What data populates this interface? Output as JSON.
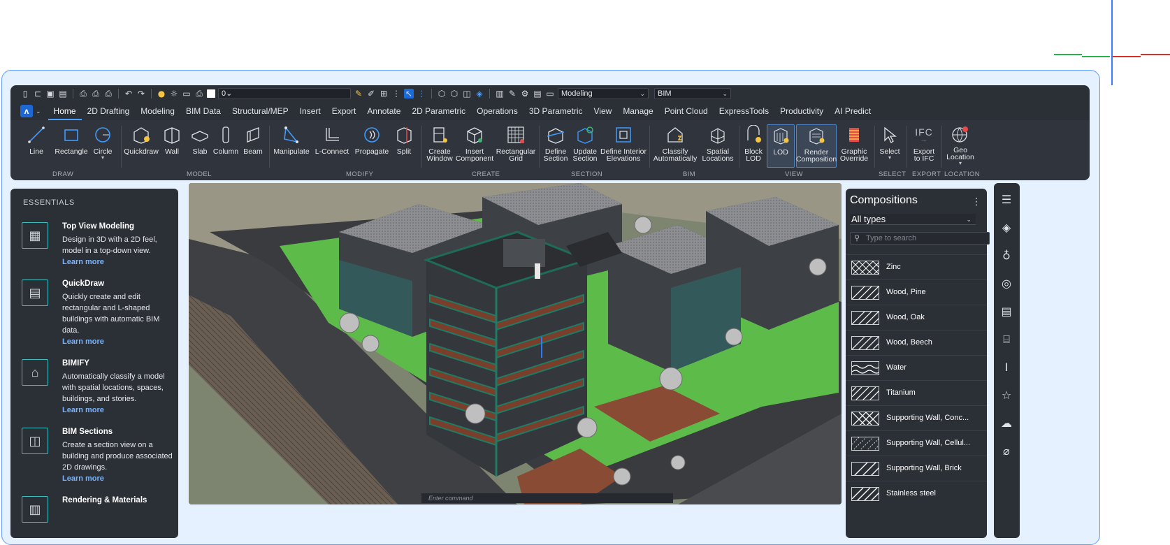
{
  "qat": {
    "layer": "0",
    "workspace": "Modeling",
    "profile": "BIM"
  },
  "tabs": [
    {
      "label": "Home",
      "active": true
    },
    {
      "label": "2D Drafting"
    },
    {
      "label": "Modeling"
    },
    {
      "label": "BIM Data"
    },
    {
      "label": "Structural/MEP"
    },
    {
      "label": "Insert"
    },
    {
      "label": "Export"
    },
    {
      "label": "Annotate"
    },
    {
      "label": "2D Parametric"
    },
    {
      "label": "Operations"
    },
    {
      "label": "3D Parametric"
    },
    {
      "label": "View"
    },
    {
      "label": "Manage"
    },
    {
      "label": "Point Cloud"
    },
    {
      "label": "ExpressTools"
    },
    {
      "label": "Productivity"
    },
    {
      "label": "AI Predict"
    }
  ],
  "ribbon": {
    "tools": [
      {
        "l1": "Line"
      },
      {
        "l1": "Rectangle"
      },
      {
        "l1": "Circle"
      },
      {
        "l1": "Quickdraw"
      },
      {
        "l1": "Wall"
      },
      {
        "l1": "Slab"
      },
      {
        "l1": "Column"
      },
      {
        "l1": "Beam"
      },
      {
        "l1": "Manipulate"
      },
      {
        "l1": "L-Connect"
      },
      {
        "l1": "Propagate"
      },
      {
        "l1": "Split"
      },
      {
        "l1": "Create",
        "l2": "Window"
      },
      {
        "l1": "Insert",
        "l2": "Component"
      },
      {
        "l1": "Rectangular",
        "l2": "Grid"
      },
      {
        "l1": "Define",
        "l2": "Section"
      },
      {
        "l1": "Update",
        "l2": "Section"
      },
      {
        "l1": "Define Interior",
        "l2": "Elevations"
      },
      {
        "l1": "Classify",
        "l2": "Automatically"
      },
      {
        "l1": "Spatial",
        "l2": "Locations"
      },
      {
        "l1": "Block",
        "l2": "LOD"
      },
      {
        "l1": "LOD"
      },
      {
        "l1": "Render",
        "l2": "Composition"
      },
      {
        "l1": "Graphic",
        "l2": "Override"
      },
      {
        "l1": "Select"
      },
      {
        "l1": "Export",
        "l2": "to IFC"
      },
      {
        "l1": "Geo",
        "l2": "Location"
      }
    ],
    "groups": [
      "DRAW",
      "MODEL",
      "MODIFY",
      "CREATE",
      "SECTION",
      "BIM",
      "VIEW",
      "SELECT",
      "EXPORT",
      "LOCATION"
    ],
    "ifc_label": "IFC"
  },
  "essentials": {
    "header": "ESSENTIALS",
    "learn_more": "Learn more",
    "items": [
      {
        "title": "Top View Modeling",
        "desc": "Design in 3D with a 2D feel, model in a top-down view."
      },
      {
        "title": "QuickDraw",
        "desc": "Quickly create and edit rectangular and L-shaped buildings with automatic BIM data."
      },
      {
        "title": "BIMIFY",
        "desc": "Automatically classify a model with spatial locations, spaces, buildings, and stories."
      },
      {
        "title": "BIM Sections",
        "desc": "Create a section view on a building and produce associated 2D drawings."
      },
      {
        "title": "Rendering & Materials",
        "desc": ""
      }
    ]
  },
  "viewport": {
    "command_placeholder": "Enter command"
  },
  "compositions": {
    "title": "Compositions",
    "filter": "All types",
    "search_placeholder": "Type to search",
    "materials": [
      {
        "name": "Zinc"
      },
      {
        "name": "Wood, Pine"
      },
      {
        "name": "Wood, Oak"
      },
      {
        "name": "Wood, Beech"
      },
      {
        "name": "Water"
      },
      {
        "name": "Titanium"
      },
      {
        "name": "Supporting Wall, Conc..."
      },
      {
        "name": "Supporting Wall, Cellul..."
      },
      {
        "name": "Supporting Wall, Brick"
      },
      {
        "name": "Stainless steel"
      }
    ]
  }
}
